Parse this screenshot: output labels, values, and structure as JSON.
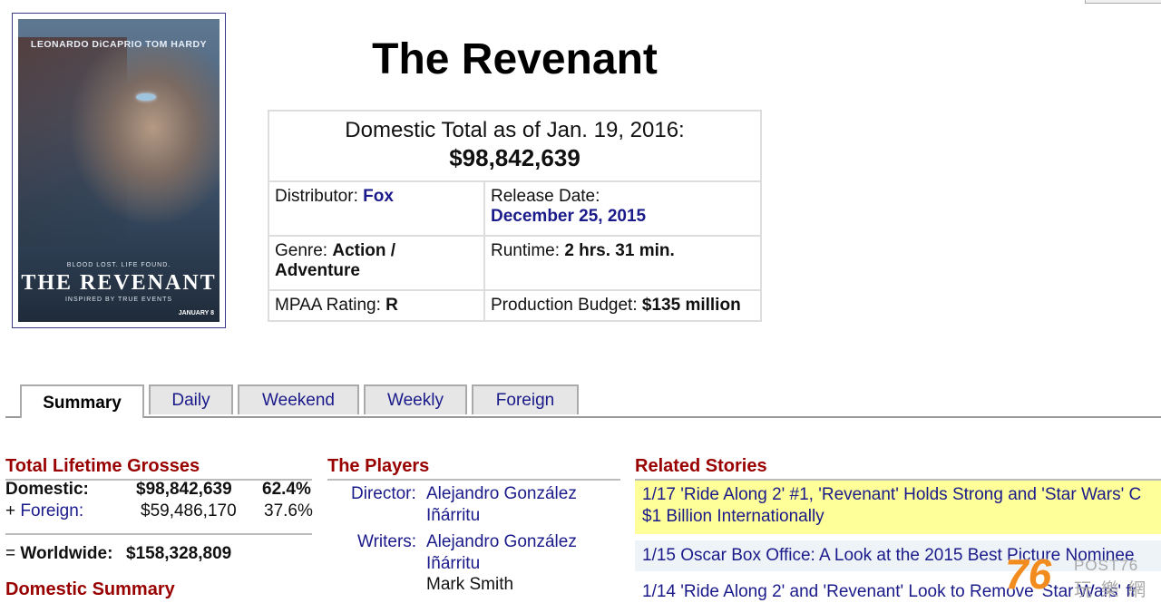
{
  "poster": {
    "actors": "LEONARDO DiCAPRIO   TOM HARDY",
    "tagline": "BLOOD LOST. LIFE FOUND.",
    "title": "THE REVENANT",
    "subtag": "INSPIRED BY TRUE EVENTS",
    "date": "JANUARY 8"
  },
  "title": "The Revenant",
  "info": {
    "total_label": "Domestic Total as of Jan. 19, 2016:",
    "total_value": "$98,842,639",
    "distributor_label": "Distributor:",
    "distributor_value": "Fox",
    "release_label": "Release Date:",
    "release_value": "December 25, 2015",
    "genre_label": "Genre:",
    "genre_value": "Action / Adventure",
    "runtime_label": "Runtime:",
    "runtime_value": "2 hrs. 31 min.",
    "mpaa_label": "MPAA Rating:",
    "mpaa_value": "R",
    "budget_label": "Production Budget:",
    "budget_value": "$135 million"
  },
  "tabs": [
    "Summary",
    "Daily",
    "Weekend",
    "Weekly",
    "Foreign"
  ],
  "grosses": {
    "title": "Total Lifetime Grosses",
    "domestic_label": "Domestic:",
    "domestic_value": "$98,842,639",
    "domestic_pct": "62.4%",
    "foreign_prefix": "+",
    "foreign_label": "Foreign:",
    "foreign_value": "$59,486,170",
    "foreign_pct": "37.6%",
    "worldwide_prefix": "=",
    "worldwide_label": "Worldwide:",
    "worldwide_value": "$158,328,809",
    "domestic_summary_title": "Domestic Summary"
  },
  "players": {
    "title": "The Players",
    "director_label": "Director:",
    "director_line1": "Alejandro González",
    "director_line2": "Iñárritu",
    "writers_label": "Writers:",
    "writer1_line1": "Alejandro González",
    "writer1_line2": "Iñárritu",
    "writer2": "Mark Smith"
  },
  "related": {
    "title": "Related Stories",
    "stories": [
      {
        "line1": "1/17 'Ride Along 2' #1, 'Revenant' Holds Strong and 'Star Wars' C",
        "line2": "$1 Billion Internationally"
      },
      {
        "line1": "1/15 Oscar Box Office: A Look at the 2015 Best Picture Nominee"
      },
      {
        "line1": "1/14 'Ride Along 2' and 'Revenant' Look to Remove 'Star Wars' fr"
      }
    ]
  },
  "watermark": {
    "digits": "76",
    "brand": "POST76",
    "cjk": "玩 樂 網"
  },
  "colors": {
    "link": "#1a1a8a",
    "section_title": "#990000",
    "highlight": "#ffff99",
    "story_bg": "#eef3f8"
  }
}
